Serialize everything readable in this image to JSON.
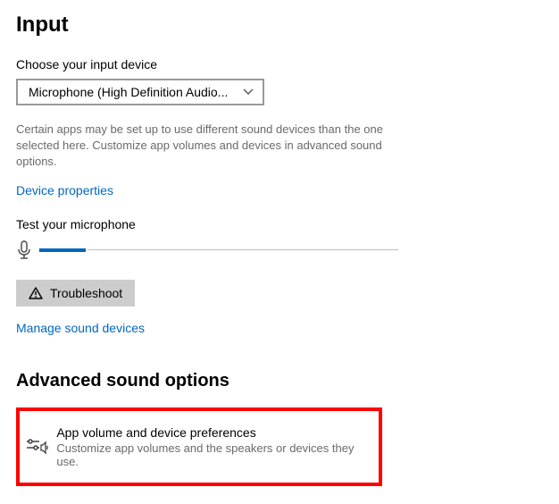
{
  "input": {
    "heading": "Input",
    "choose_label": "Choose your input device",
    "device_selected": "Microphone (High Definition Audio...",
    "note": "Certain apps may be set up to use different sound devices than the one selected here. Customize app volumes and devices in advanced sound options.",
    "device_properties_link": "Device properties",
    "test_label": "Test your microphone",
    "mic_level_percent": 13,
    "troubleshoot_label": "Troubleshoot",
    "manage_link": "Manage sound devices"
  },
  "advanced": {
    "heading": "Advanced sound options",
    "option_title": "App volume and device preferences",
    "option_desc": "Customize app volumes and the speakers or devices they use."
  }
}
